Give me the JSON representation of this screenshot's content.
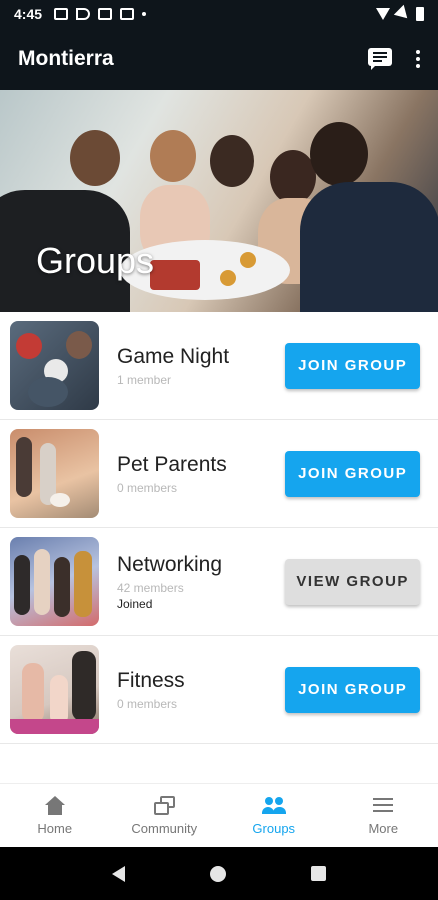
{
  "status_bar": {
    "time": "4:45"
  },
  "app_bar": {
    "title": "Montierra"
  },
  "hero": {
    "title": "Groups"
  },
  "groups": [
    {
      "name": "Game Night",
      "members": "1 member",
      "joined": "",
      "button": "JOIN GROUP"
    },
    {
      "name": "Pet Parents",
      "members": "0 members",
      "joined": "",
      "button": "JOIN GROUP"
    },
    {
      "name": "Networking",
      "members": "42 members",
      "joined": "Joined",
      "button": "VIEW GROUP"
    },
    {
      "name": "Fitness",
      "members": "0 members",
      "joined": "",
      "button": "JOIN GROUP"
    }
  ],
  "bottom_nav": {
    "items": [
      {
        "label": "Home",
        "icon": "home-icon"
      },
      {
        "label": "Community",
        "icon": "community-icon"
      },
      {
        "label": "Groups",
        "icon": "groups-icon"
      },
      {
        "label": "More",
        "icon": "menu-icon"
      }
    ],
    "active": "Groups"
  },
  "colors": {
    "accent": "#15a5ee",
    "appbar": "#0e151b",
    "secondary_button": "#dedede"
  }
}
